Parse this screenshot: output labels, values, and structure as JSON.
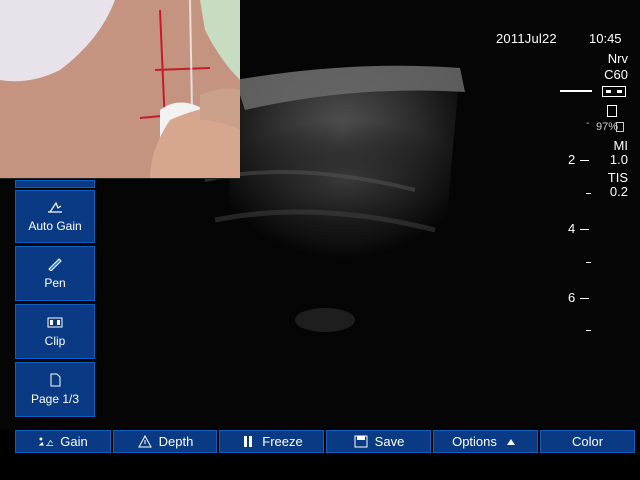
{
  "status": {
    "date": "2011Jul22",
    "time": "10:45",
    "preset": "Nrv",
    "transducer": "C60",
    "battery_percent": "97%",
    "mi_label": "MI",
    "mi_value": "1.0",
    "tis_label": "TIS",
    "tis_value": "0.2"
  },
  "depth_scale": {
    "labels": [
      "2",
      "4",
      "6"
    ]
  },
  "sidebar": {
    "items": [
      {
        "label": "Auto Gain",
        "icon": "auto-gain-icon"
      },
      {
        "label": "Pen",
        "icon": "pen-icon"
      },
      {
        "label": "Clip",
        "icon": "clip-icon"
      },
      {
        "label": "Page 1/3",
        "icon": "page-icon"
      }
    ]
  },
  "bottom_bar": {
    "items": [
      {
        "label": "Gain",
        "icon": "gain-icon"
      },
      {
        "label": "Depth",
        "icon": "depth-icon"
      },
      {
        "label": "Freeze",
        "icon": "freeze-icon"
      },
      {
        "label": "Save",
        "icon": "save-icon"
      },
      {
        "label": "Options",
        "icon": "up-arrow-icon"
      },
      {
        "label": "Color",
        "icon": ""
      }
    ]
  },
  "colors": {
    "button_bg": "#0b3a84",
    "button_border": "#0f5fbf",
    "screen_bg": "#050505"
  }
}
